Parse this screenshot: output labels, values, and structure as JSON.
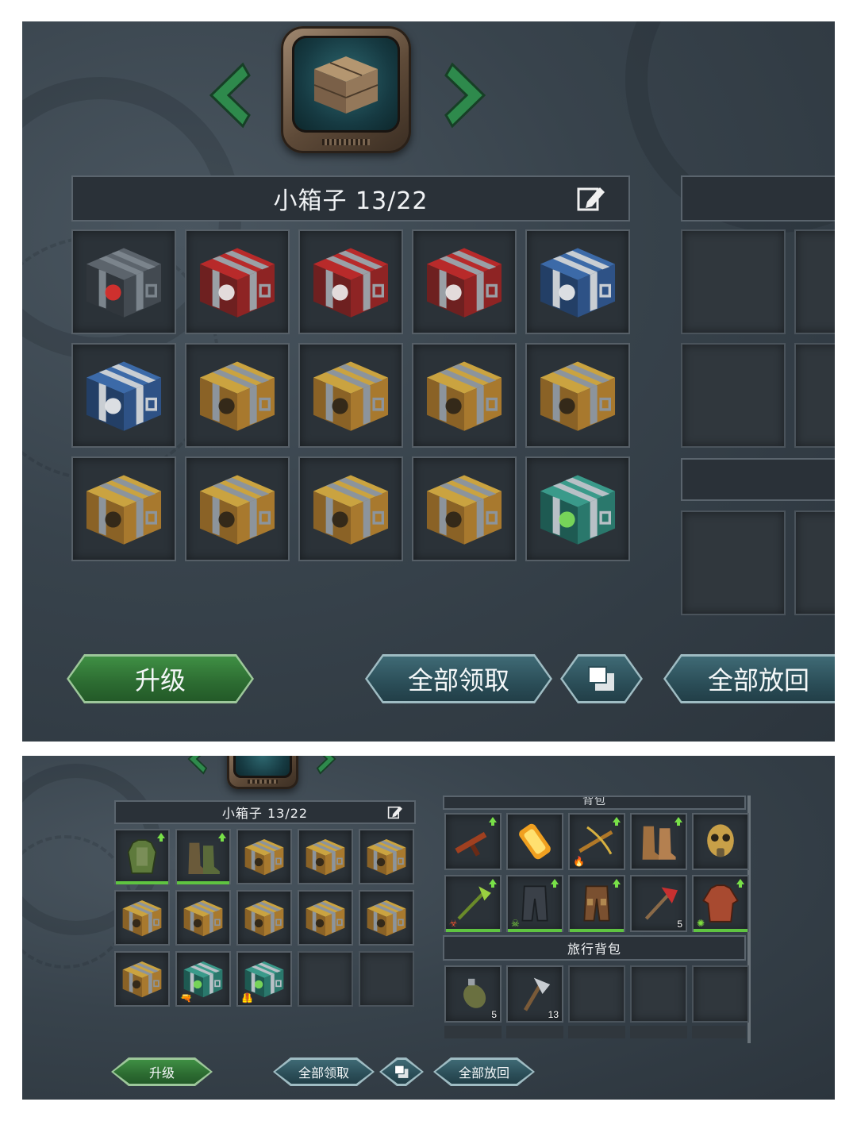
{
  "colors": {
    "upgrade_button": "#2c6b31",
    "action_button": "#2b4e58",
    "equip_underline": "#5fc441",
    "upgrade_arrow": "#78e048"
  },
  "top": {
    "container_icon": "wooden-crate-icon",
    "title": "小箱子 13/22",
    "grid": [
      "gray-tech-case",
      "red-case",
      "red-case",
      "red-case",
      "blue-case",
      "blue-case",
      "gold-radiation-chest",
      "gold-radiation-chest",
      "gold-radiation-chest",
      "gold-radiation-chest",
      "gold-radiation-chest",
      "gold-radiation-chest",
      "gold-radiation-chest",
      "gold-radiation-chest",
      "teal-supply-case"
    ],
    "buttons": {
      "upgrade": "升级",
      "claim_all": "全部领取",
      "return_all": "全部放回"
    }
  },
  "bottom": {
    "title": "小箱子 13/22",
    "left_grid": [
      {
        "item": "green-armor-vest",
        "upgrade": true,
        "equipped": true
      },
      {
        "item": "green-boots",
        "upgrade": true,
        "equipped": true
      },
      {
        "item": "gold-radiation-chest"
      },
      {
        "item": "gold-radiation-chest"
      },
      {
        "item": "gold-radiation-chest"
      },
      {
        "item": "gold-radiation-chest"
      },
      {
        "item": "gold-radiation-chest"
      },
      {
        "item": "gold-radiation-chest"
      },
      {
        "item": "gold-radiation-chest"
      },
      {
        "item": "gold-radiation-chest"
      },
      {
        "item": "gold-radiation-chest"
      },
      {
        "item": "teal-supply-case",
        "badge": "pistol"
      },
      {
        "item": "teal-supply-case",
        "badge": "vest"
      },
      {
        "item": ""
      },
      {
        "item": ""
      }
    ],
    "equipment_title": "背包",
    "equipment": [
      {
        "item": "assault-rifle",
        "upgrade": true
      },
      {
        "item": "energy-cell"
      },
      {
        "item": "crossbow",
        "upgrade": true,
        "badge": "fire"
      },
      {
        "item": "leather-boots",
        "upgrade": true
      },
      {
        "item": "gas-mask"
      },
      {
        "item": "toxic-axe",
        "upgrade": true,
        "badge": "biohazard",
        "equipped": true
      },
      {
        "item": "combat-pants",
        "upgrade": true,
        "badge": "skull",
        "equipped": true
      },
      {
        "item": "armored-pants",
        "upgrade": true,
        "equipped": true
      },
      {
        "item": "fire-axe",
        "count": "5"
      },
      {
        "item": "red-jacket",
        "upgrade": true,
        "badge": "toxic",
        "equipped": true
      }
    ],
    "travel_bag_title": "旅行背包",
    "travel_bag": [
      {
        "item": "grenade",
        "count": "5"
      },
      {
        "item": "hatchet",
        "count": "13"
      },
      {
        "item": ""
      },
      {
        "item": ""
      },
      {
        "item": ""
      }
    ],
    "buttons": {
      "upgrade": "升级",
      "claim_all": "全部领取",
      "return_all": "全部放回"
    }
  }
}
